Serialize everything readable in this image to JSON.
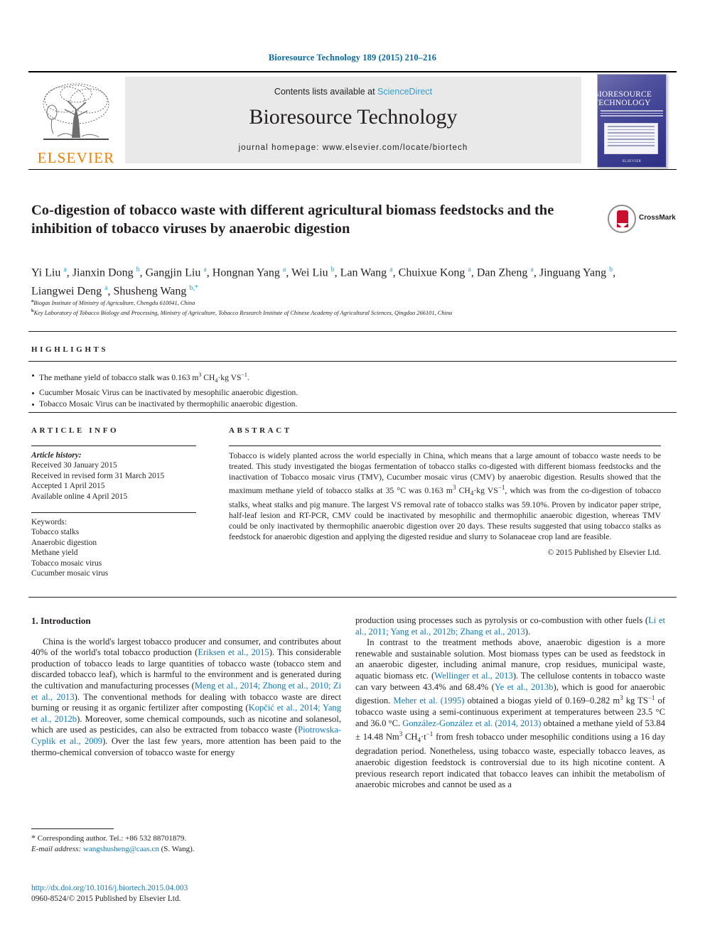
{
  "running_head": "Bioresource Technology 189 (2015) 210–216",
  "masthead": {
    "contents_prefix": "Contents lists available at ",
    "contents_link": "ScienceDirect",
    "journal_name": "Bioresource Technology",
    "homepage": "journal homepage: www.elsevier.com/locate/biortech",
    "publisher_logo_text": "ELSEVIER",
    "cover_title_line1": "BIORESOURCE",
    "cover_title_line2": "TECHNOLOGY",
    "cover_publisher": "ELSEVIER",
    "accent_blue": "#0b6aa2",
    "link_blue": "#2f9fd0",
    "elsevier_orange": "#f08000"
  },
  "crossmark": {
    "label": "CrossMark",
    "badge_color": "#c8102e"
  },
  "article": {
    "title": "Co-digestion of tobacco waste with different agricultural biomass feedstocks and the inhibition of tobacco viruses by anaerobic digestion",
    "authors_html": "Yi Liu <sup>a</sup>, Jianxin Dong <sup>b</sup>, Gangjin Liu <sup>a</sup>, Hongnan Yang <sup>a</sup>, Wei Liu <sup>b</sup>, Lan Wang <sup>a</sup>, Chuixue Kong <sup>a</sup>, Dan Zheng <sup>a</sup>, Jinguang Yang <sup>b</sup>, Liangwei Deng <sup>a</sup>, Shusheng Wang <sup>b,*</sup>",
    "affiliation_a": "Biogas Institute of Ministry of Agriculture, Chengdu 610041, China",
    "affiliation_b": "Key Laboratory of Tobacco Biology and Processing, Ministry of Agriculture, Tobacco Research Institute of Chinese Academy of Agricultural Sciences, Qingdao 266101, China"
  },
  "highlights": {
    "heading": "HIGHLIGHTS",
    "items_html": [
      "The methane yield of tobacco stalk was 0.163 m<sup class=\"hi\">3</sup> CH<sub class=\"hi\">4</sub>·kg VS<sup class=\"hi\">−1</sup>.",
      "Cucumber Mosaic Virus can be inactivated by mesophilic anaerobic digestion.",
      "Tobacco Mosaic Virus can be inactivated by thermophilic anaerobic digestion."
    ]
  },
  "article_info": {
    "heading": "ARTICLE INFO",
    "history_label": "Article history:",
    "history": [
      "Received 30 January 2015",
      "Received in revised form 31 March 2015",
      "Accepted 1 April 2015",
      "Available online 4 April 2015"
    ],
    "keywords_label": "Keywords:",
    "keywords": [
      "Tobacco stalks",
      "Anaerobic digestion",
      "Methane yield",
      "Tobacco mosaic virus",
      "Cucumber mosaic virus"
    ]
  },
  "abstract": {
    "heading": "ABSTRACT",
    "text_html": "Tobacco is widely planted across the world especially in China, which means that a large amount of tobacco waste needs to be treated. This study investigated the biogas fermentation of tobacco stalks co-digested with different biomass feedstocks and the inactivation of Tobacco mosaic virus (TMV), Cucumber mosaic virus (CMV) by anaerobic digestion. Results showed that the maximum methane yield of tobacco stalks at 35 &deg;C was 0.163 m<sup class=\"u\">3</sup> CH<sub class=\"u\">4</sub>·kg VS<sup class=\"u\">−1</sup>, which was from the co-digestion of tobacco stalks, wheat stalks and pig manure. The largest VS removal rate of tobacco stalks was 59.10%. Proven by indicator paper stripe, half-leaf lesion and RT-PCR, CMV could be inactivated by mesophilic and thermophilic anaerobic digestion, whereas TMV could be only inactivated by thermophilic anaerobic digestion over 20 days. These results suggested that using tobacco stalks as feedstock for anaerobic digestion and applying the digested residue and slurry to Solanaceae crop land are feasible.",
    "copyright": "© 2015 Published by Elsevier Ltd."
  },
  "introduction": {
    "heading": "1. Introduction",
    "left_paragraph_html": "China is the world's largest tobacco producer and consumer, and contributes about 40% of the world's total tobacco production (<span class=\"ref\">Eriksen et al., 2015</span>). This considerable production of tobacco leads to large quantities of tobacco waste (tobacco stem and discarded tobacco leaf), which is harmful to the environment and is generated during the cultivation and manufacturing processes (<span class=\"ref\">Meng et al., 2014; Zhong et al., 2010; Zi et al., 2013</span>). The conventional methods for dealing with tobacco waste are direct burning or reusing it as organic fertilizer after composting (<span class=\"ref\">Kopčić et al., 2014; Yang et al., 2012b</span>). Moreover, some chemical compounds, such as nicotine and solanesol, which are used as pesticides, can also be extracted from tobacco waste (<span class=\"ref\">Piotrowska-Cyplik et al., 2009</span>). Over the last few years, more attention has been paid to the thermo-chemical conversion of tobacco waste for energy",
    "right_paragraph_1_html": "production using processes such as pyrolysis or co-combustion with other fuels (<span class=\"ref\">Li et al., 2011; Yang et al., 2012b; Zhang et al., 2013</span>).",
    "right_paragraph_2_html": "In contrast to the treatment methods above, anaerobic digestion is a more renewable and sustainable solution. Most biomass types can be used as feedstock in an anaerobic digester, including animal manure, crop residues, municipal waste, aquatic biomass etc. (<span class=\"ref\">Wellinger et al., 2013</span>). The cellulose contents in tobacco waste can vary between 43.4% and 68.4% (<span class=\"ref\">Ye et al., 2013b</span>), which is good for anaerobic digestion. <span class=\"ref\">Meher et al. (1995)</span> obtained a biogas yield of 0.169–0.282 m<sup class=\"u\">3</sup> kg TS<sup class=\"u\">−1</sup> of tobacco waste using a semi-continuous experiment at temperatures between 23.5 &deg;C and 36.0 &deg;C. <span class=\"ref\">González-González et al. (2014, 2013)</span> obtained a methane yield of 53.84 ± 14.48 Nm<sup class=\"u\">3</sup> CH<sub class=\"u\">4</sub>·t<sup class=\"u\">−1</sup> from fresh tobacco under mesophilic conditions using a 16 day degradation period. Nonetheless, using tobacco waste, especially tobacco leaves, as anaerobic digestion feedstock is controversial due to its high nicotine content. A previous research report indicated that tobacco leaves can inhibit the metabolism of anaerobic microbes and cannot be used as a"
  },
  "footnote": {
    "corresponding_html": "<span style=\"font-size:12px\">*</span> Corresponding author. Tel.: +86 532 88701879.",
    "email_label": "E-mail address:",
    "email": "wangshusheng@caas.cn",
    "email_suffix": "(S. Wang)."
  },
  "footer": {
    "doi": "http://dx.doi.org/10.1016/j.biortech.2015.04.003",
    "issn_line": "0960-8524/© 2015 Published by Elsevier Ltd."
  }
}
